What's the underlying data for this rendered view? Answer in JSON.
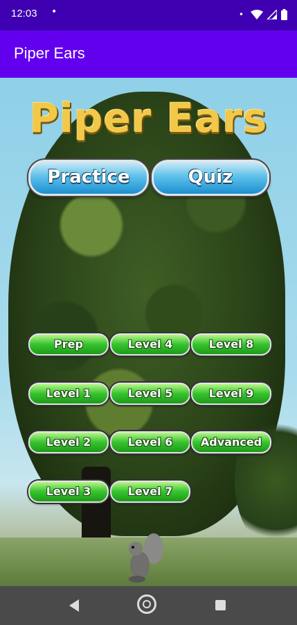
{
  "status_bar": {
    "time": "12:03",
    "notification_dot": "•",
    "dot_left": "•",
    "icons": [
      "wifi-icon",
      "signal-icon",
      "battery-icon"
    ]
  },
  "app_bar": {
    "title": "Piper Ears"
  },
  "main": {
    "logo_text": "Piper Ears",
    "mode_buttons": [
      {
        "label": "Practice"
      },
      {
        "label": "Quiz"
      }
    ],
    "levels": [
      {
        "label": "Prep"
      },
      {
        "label": "Level 1"
      },
      {
        "label": "Level 2"
      },
      {
        "label": "Level 3"
      },
      {
        "label": "Level 4"
      },
      {
        "label": "Level 5"
      },
      {
        "label": "Level 6"
      },
      {
        "label": "Level 7"
      },
      {
        "label": "Level 8"
      },
      {
        "label": "Level 9"
      },
      {
        "label": "Advanced"
      }
    ]
  },
  "nav_bar": {
    "icons": [
      "back-icon",
      "home-icon",
      "recents-icon"
    ]
  },
  "colors": {
    "status_bar": "#3e00b0",
    "app_bar": "#6200ee",
    "logo": "#f2c84a",
    "mode_button": "#1c8fd0",
    "level_button": "#35c32d"
  }
}
